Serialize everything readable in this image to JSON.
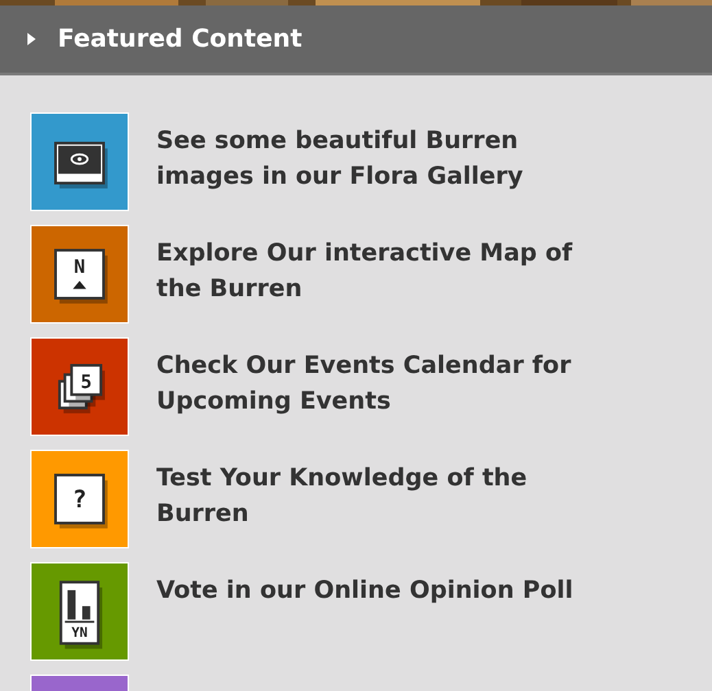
{
  "header": {
    "title": "Featured Content"
  },
  "items": [
    {
      "kind": "gallery",
      "color": "#3399cc",
      "lines": [
        "See some beautiful Burren",
        "images in our Flora Gallery"
      ]
    },
    {
      "kind": "map",
      "color": "#cc6600",
      "glyph": "N",
      "lines": [
        "Explore Our interactive Map of",
        "the Burren"
      ]
    },
    {
      "kind": "calendar",
      "color": "#cc3300",
      "glyph": "5",
      "lines": [
        "Check Our Events Calendar for",
        "Upcoming Events"
      ]
    },
    {
      "kind": "quiz",
      "color": "#ff9900",
      "glyph": "?",
      "lines": [
        "Test Your Knowledge of the",
        "Burren"
      ]
    },
    {
      "kind": "poll",
      "color": "#669900",
      "glyph": "YN",
      "lines": [
        "Vote in our Online Opinion Poll"
      ]
    },
    {
      "kind": "blank",
      "color": "#9966cc"
    }
  ]
}
